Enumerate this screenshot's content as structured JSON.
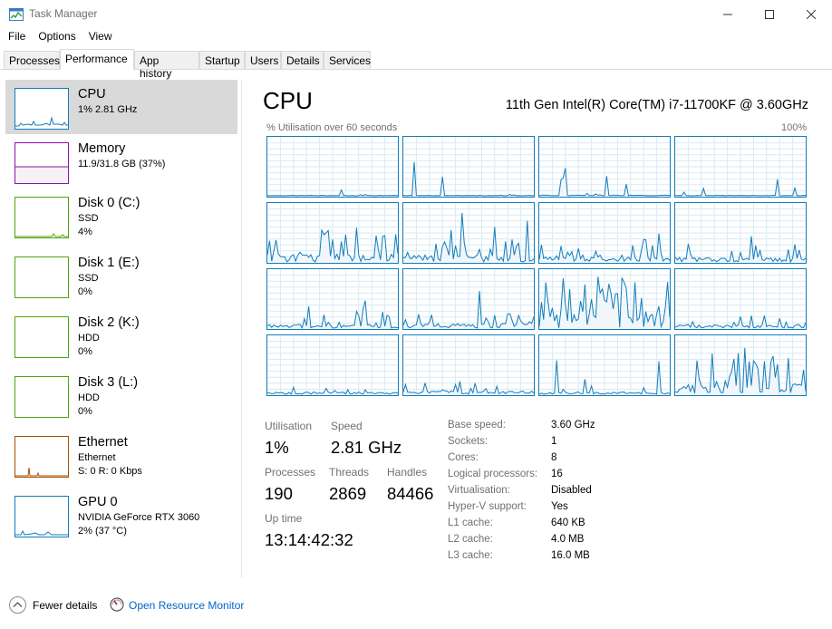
{
  "window": {
    "title": "Task Manager"
  },
  "menu": [
    "File",
    "Options",
    "View"
  ],
  "tabs": [
    "Processes",
    "Performance",
    "App history",
    "Startup",
    "Users",
    "Details",
    "Services"
  ],
  "active_tab": "Performance",
  "sidebar": {
    "items": [
      {
        "title": "CPU",
        "sub1": "1% 2.81 GHz",
        "sub2": "",
        "sub3": "",
        "color": "#117dbb"
      },
      {
        "title": "Memory",
        "sub1": "11.9/31.8 GB (37%)",
        "sub2": "",
        "sub3": "",
        "color": "#8b12ae"
      },
      {
        "title": "Disk 0 (C:)",
        "sub1": "SSD",
        "sub2": "4%",
        "sub3": "",
        "color": "#4da60c"
      },
      {
        "title": "Disk 1 (E:)",
        "sub1": "SSD",
        "sub2": "0%",
        "sub3": "",
        "color": "#4da60c"
      },
      {
        "title": "Disk 2 (K:)",
        "sub1": "HDD",
        "sub2": "0%",
        "sub3": "",
        "color": "#4da60c"
      },
      {
        "title": "Disk 3 (L:)",
        "sub1": "HDD",
        "sub2": "0%",
        "sub3": "",
        "color": "#4da60c"
      },
      {
        "title": "Ethernet",
        "sub1": "Ethernet",
        "sub2": "S: 0 R: 0 Kbps",
        "sub3": "",
        "color": "#a74f01"
      },
      {
        "title": "GPU 0",
        "sub1": "NVIDIA GeForce RTX 3060",
        "sub2": "2% (37 °C)",
        "sub3": "",
        "color": "#117dbb"
      }
    ]
  },
  "cpu": {
    "title": "CPU",
    "model": "11th Gen Intel(R) Core(TM) i7-11700KF @ 3.60GHz",
    "graph_caption": "% Utilisation over 60 seconds",
    "graph_max": "100%",
    "graph_color": "#117dbb",
    "graph_fill": "#f1f6fa",
    "logical_graph_count": 16
  },
  "stats": {
    "utilisation_label": "Utilisation",
    "utilisation_value": "1%",
    "speed_label": "Speed",
    "speed_value": "2.81 GHz",
    "processes_label": "Processes",
    "processes_value": "190",
    "threads_label": "Threads",
    "threads_value": "2869",
    "handles_label": "Handles",
    "handles_value": "84466",
    "uptime_label": "Up time",
    "uptime_value": "13:14:42:32"
  },
  "specs": [
    {
      "label": "Base speed:",
      "value": "3.60 GHz"
    },
    {
      "label": "Sockets:",
      "value": "1"
    },
    {
      "label": "Cores:",
      "value": "8"
    },
    {
      "label": "Logical processors:",
      "value": "16"
    },
    {
      "label": "Virtualisation:",
      "value": "Disabled"
    },
    {
      "label": "Hyper-V support:",
      "value": "Yes"
    },
    {
      "label": "L1 cache:",
      "value": "640 KB"
    },
    {
      "label": "L2 cache:",
      "value": "4.0 MB"
    },
    {
      "label": "L3 cache:",
      "value": "16.0 MB"
    }
  ],
  "footer": {
    "fewer_details": "Fewer details",
    "open_resource_monitor": "Open Resource Monitor"
  }
}
